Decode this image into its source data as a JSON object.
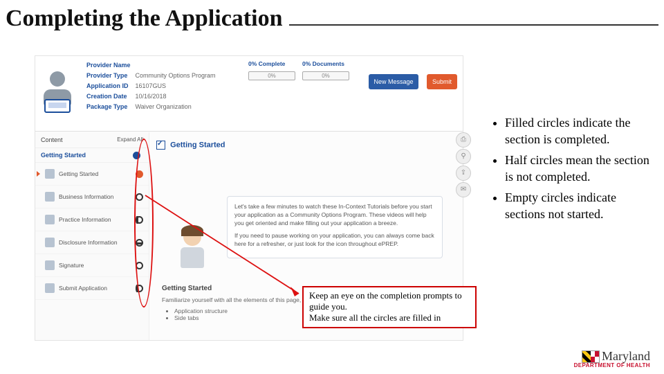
{
  "title": "Completing the Application",
  "header": {
    "meta": {
      "provider_name_k": "Provider Name",
      "provider_name_v": "",
      "provider_type_k": "Provider Type",
      "provider_type_v": "Community Options Program",
      "app_id_k": "Application ID",
      "app_id_v": "16107GUS",
      "created_k": "Creation Date",
      "created_v": "10/16/2018",
      "pkg_k": "Package Type",
      "pkg_v": "Waiver Organization"
    },
    "progress": {
      "complete_label": "0% Complete",
      "complete_bar": "0%",
      "docs_label": "0% Documents",
      "docs_bar": "0%"
    },
    "buttons": {
      "new_message": "New Message",
      "submit": "Submit"
    }
  },
  "sidebar": {
    "title": "Content",
    "expand": "Expand All",
    "section": "Getting Started",
    "items": [
      {
        "label": "Getting Started",
        "status": "filled-orange",
        "caret": true
      },
      {
        "label": "Business Information",
        "status": "empty"
      },
      {
        "label": "Practice Information",
        "status": "half-v"
      },
      {
        "label": "Disclosure Information",
        "status": "half-h"
      },
      {
        "label": "Signature",
        "status": "empty"
      },
      {
        "label": "Submit Application",
        "status": "half-v"
      }
    ]
  },
  "main": {
    "heading": "Getting Started",
    "tutor": {
      "p1": "Let's take a few minutes to watch these In-Context Tutorials before you start your application as a Community Options Program. These videos will help you get oriented and make filling out your application a breeze.",
      "p2": "If you need to pause working on your application, you can always come back here for a refresher, or just look for the icon throughout ePREP."
    },
    "subsection": {
      "heading": "Getting Started",
      "intro": "Familiarize yourself with all the elements of this page, including:",
      "b1": "Application structure",
      "b2": "Side tabs"
    },
    "icons": [
      "print-icon",
      "link-icon",
      "share-icon",
      "mail-icon"
    ]
  },
  "callout": {
    "l1": "Keep an eye on the completion prompts to guide you.",
    "l2": "Make sure all the circles are filled in"
  },
  "legend": {
    "b1": "Filled circles indicate  the section is completed.",
    "b2": "Half circles mean the section is not completed.",
    "b3": "Empty circles indicate sections not started."
  },
  "logo": {
    "name": "Maryland",
    "sub": "DEPARTMENT OF HEALTH"
  }
}
